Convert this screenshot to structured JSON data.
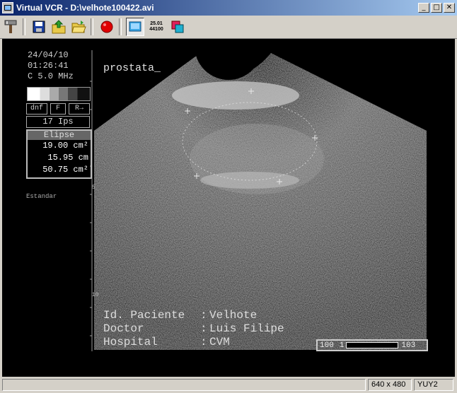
{
  "window": {
    "title": "Virtual VCR - D:\\velhote100422.avi"
  },
  "window_controls": {
    "minimize": "_",
    "maximize": "□",
    "close": "✕"
  },
  "toolbar": {
    "buttons": [
      {
        "name": "settings-tool-button",
        "icon": "tools-icon"
      },
      {
        "name": "save-button",
        "icon": "floppy-disk-icon"
      },
      {
        "name": "export-button",
        "icon": "folder-up-icon"
      },
      {
        "name": "open-button",
        "icon": "folder-open-icon"
      },
      {
        "name": "record-button",
        "icon": "record-icon"
      },
      {
        "name": "preview-button",
        "icon": "monitor-icon"
      },
      {
        "name": "framerate-button",
        "icon": "framerate-icon"
      },
      {
        "name": "overlay-button",
        "icon": "overlay-icon"
      }
    ],
    "framerate_line1": "25.01",
    "framerate_line2": "44100"
  },
  "video": {
    "date": "24/04/10",
    "time": "01:26:41",
    "probe": "C 5.0 MHz",
    "btn_dnf": "dnf",
    "btn_f": "F",
    "btn_r": "R→",
    "fps": "17 Ips",
    "measure_title": "Elipse",
    "measure_area": "19.00 cm²",
    "measure_perimeter": "15.95 cm",
    "measure_area2": "50.75 cm²",
    "preset": "Estandar",
    "annotation": "prostata_",
    "scale_marker_left": "5",
    "scale_marker_bottom": "10",
    "patient_label": "Id. Paciente",
    "patient_value": "Velhote",
    "doctor_label": "Doctor",
    "doctor_value": "Luis Filipe",
    "hospital_label": "Hospital",
    "hospital_value": "CVM",
    "colon": ":",
    "gauge_left": "100",
    "gauge_mid": "1",
    "gauge_right": "103"
  },
  "status": {
    "resolution": "640 x 480",
    "format": "YUY2"
  }
}
